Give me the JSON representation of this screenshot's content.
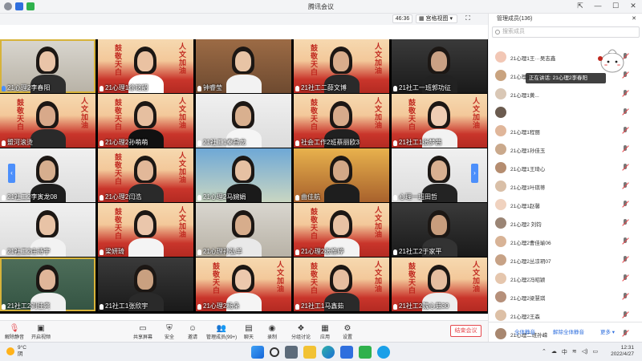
{
  "window": {
    "title": "腾讯会议",
    "controls": [
      "⇱",
      "—",
      "☐",
      "✕"
    ]
  },
  "header": {
    "timer": "46:36",
    "view_label": "▦ 宫格视图 ▾",
    "fullscreen_icon": "⛶"
  },
  "tiles": [
    {
      "name": "21心理2李春阳",
      "bg": "room",
      "skin": "#e9c4a8",
      "shirt": "#2e2e2e",
      "mic_blue": true,
      "active": true
    },
    {
      "name": "21心理1徐铭韶",
      "bg": "banner",
      "skin": "#eac2a2",
      "shirt": "#ffffff"
    },
    {
      "name": "钟睿莹",
      "bg": "shelf",
      "skin": "#e8c4a5",
      "shirt": "#f2f2f2"
    },
    {
      "name": "21社工二薛文博",
      "bg": "banner",
      "skin": "#d9ad8c",
      "shirt": "#2a2a2a"
    },
    {
      "name": "21社工一班郭功征",
      "bg": "dark",
      "skin": "#caa184",
      "shirt": "#222"
    },
    {
      "name": "盟河滚烫",
      "bg": "banner",
      "skin": "#d8a98a",
      "shirt": "#2a2a2a"
    },
    {
      "name": "21心理2孙萌萌",
      "bg": "banner",
      "skin": "#e6bfa0",
      "shirt": "#111"
    },
    {
      "name": "21社工1秦昌龙",
      "bg": "white",
      "skin": "#d9b08f",
      "shirt": "#f5f5f5"
    },
    {
      "name": "社会工作2班蔡丽欧3",
      "bg": "banner",
      "skin": "#d7ab8b",
      "shirt": "#202020"
    },
    {
      "name": "21社工1张梦茜",
      "bg": "banner",
      "skin": "#efcdb4",
      "shirt": "#f2f2f2"
    },
    {
      "name": "21社工2李寅龙08",
      "bg": "white",
      "skin": "#d6ae8e",
      "shirt": "#1e1e1e"
    },
    {
      "name": "21心理2闫浩",
      "bg": "banner",
      "skin": "#e2b899",
      "shirt": "#2a2a2a"
    },
    {
      "name": "21心理2马婉娟",
      "bg": "sky",
      "skin": "#e6c1a3",
      "shirt": "#1a1a1a"
    },
    {
      "name": "曲佳航",
      "bg": "castle",
      "skin": "#d3a887",
      "shirt": "#1e1e1e"
    },
    {
      "name": "心理一班田哲",
      "bg": "white",
      "skin": "#d9b091",
      "shirt": "#232323"
    },
    {
      "name": "21社工2庄诗宇",
      "bg": "white",
      "skin": "#e8c3a6",
      "shirt": "#f2f2f2"
    },
    {
      "name": "梁妍琦",
      "bg": "banner",
      "skin": "#eac6ab",
      "shirt": "#f4f4f4"
    },
    {
      "name": "21心理孙弘羊",
      "bg": "room",
      "skin": "#d7ad8c",
      "shirt": "#e9e9e9"
    },
    {
      "name": "21心理2张惟婷",
      "bg": "banner",
      "skin": "#e8c2a4",
      "shirt": "#f3f3f3"
    },
    {
      "name": "21社工2于家平",
      "bg": "dark",
      "skin": "#c89d7d",
      "shirt": "#333"
    },
    {
      "name": "21社工2刘佳爽",
      "bg": "green",
      "skin": "#e0b699",
      "shirt": "#f0f0f0",
      "active": true
    },
    {
      "name": "21社工1张欣宇",
      "bg": "dark",
      "skin": "#c9a080",
      "shirt": "#2a2a2a"
    },
    {
      "name": "21心理2杨朵",
      "bg": "banner",
      "skin": "#ecc8ad",
      "shirt": "#f5f5f5"
    },
    {
      "name": "21社工1马鑫茹",
      "bg": "banner",
      "skin": "#e6bea0",
      "shirt": "#2a2a2a"
    },
    {
      "name": "21社工2魏心茹30",
      "bg": "banner",
      "skin": "#e6bea0",
      "shirt": "#ededed"
    }
  ],
  "banner": {
    "left_text": "鼓敬天白",
    "right_text": "人文加油"
  },
  "pager": {
    "left": "‹",
    "right": "›"
  },
  "toolbar": {
    "mute": "解除静音",
    "video": "开启视频",
    "share": "共享屏幕",
    "security": "安全",
    "invite": "邀请",
    "members": "管理成员(99+)",
    "chat": "聊天",
    "record": "录制",
    "breakout": "分组讨论",
    "apps": "应用",
    "settings": "设置",
    "end": "结束会议"
  },
  "panel": {
    "title": "管理成员(136)",
    "close": "✕",
    "search_placeholder": "搜索成员",
    "toast": "正在讲话: 21心理2李春阳",
    "members": [
      "21心理1王···吴志鑫",
      "21心理1杨晶淇",
      "21心理1黄...",
      "",
      "21心理1程丽",
      "21心理1孙佳玉",
      "21心理1王琦心",
      "21心理1叶琪蒂",
      "21心理1赵馨",
      "21心理2 刘钧",
      "21心理2曹佳瑜06",
      "21心理2丛凉玥07",
      "21心理2冯昭颖",
      "21心理2梁慧琪",
      "21心理2王森",
      "21心理二班孙嵘"
    ],
    "footer": {
      "mute_all": "全体静音",
      "unmute_all": "解除全体静音",
      "more": "更多 ▾"
    }
  },
  "taskbar": {
    "temperature": "9°C",
    "weather": "阴",
    "time": "12:31",
    "date": "2022/4/27"
  },
  "colors": {
    "accent": "#4c8ffb",
    "danger": "#e5484d",
    "banner_red": "#c0281f"
  }
}
